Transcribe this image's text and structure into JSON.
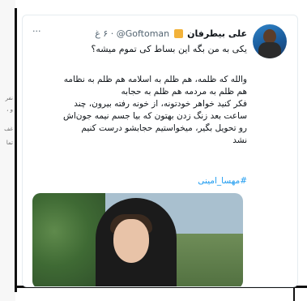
{
  "left_panel": {
    "fragments": [
      "نفر",
      "و ،",
      "غف",
      "تما"
    ]
  },
  "tweet": {
    "display_name": "علی بیطرفان",
    "handle": "@Goftoman",
    "time": "۶ غ",
    "more_icon": "more-dots-icon",
    "reply": "یکی  به من بگه این بساط کی تموم میشه؟",
    "text_lines": [
      "والله که ظلمه، هم ظلم به اسلامه هم ظلم به نظامه",
      "هم ظلم به مردمه هم ظلم به حجابه",
      "فکر کنید خواهر خودتونه، از خونه رفته بیرون، چند",
      "ساعت بعد زنگ زدن بهتون که بیا جسم نیمه جون‌اش",
      "رو تحویل بگیر، میخواستیم حجابشو درست کنیم",
      "نشد"
    ],
    "hashtag": "#مهسا_امینی",
    "colors": {
      "link": "#1d9bf0",
      "text": "#0f1419",
      "secondary": "#536471"
    }
  }
}
